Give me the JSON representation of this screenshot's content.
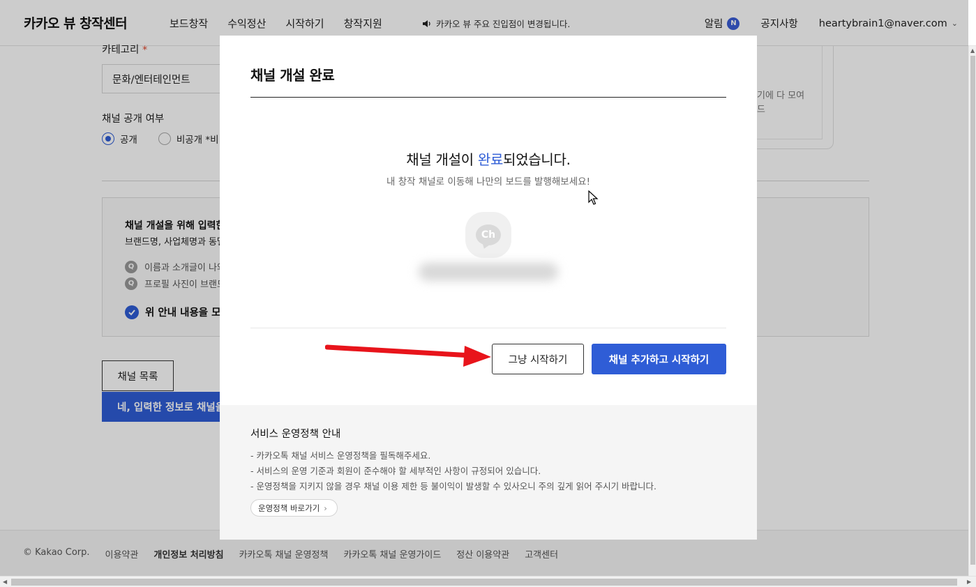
{
  "header": {
    "logo": "카카오 뷰 창작센터",
    "nav": [
      "보드창작",
      "수익정산",
      "시작하기",
      "창작지원"
    ],
    "notice": "카카오 뷰 주요 진입점이 변경됩니다.",
    "alarm_label": "알림",
    "alarm_badge": "N",
    "notice_link": "공지사항",
    "user_email": "heartybrain1@naver.com"
  },
  "form": {
    "category_label": "카테고리",
    "category_required": "*",
    "category_value": "문화/엔터테인먼트",
    "visibility_label": "채널 공개 여부",
    "visibility_options": [
      "공개",
      "비공개 *비"
    ],
    "selected_option": "공개",
    "info_title": "채널 개설을 위해 입력한",
    "info_sub": "브랜드명, 사업체명과 동떨",
    "faq": [
      "이름과 소개글이 나와",
      "프로필 사진이 브랜드"
    ],
    "faq_icon_label": "Q",
    "agree_label": "위 안내 내용을 모두",
    "channel_list_button": "채널 목록",
    "confirm_button": "네, 입력한 정보로 채널을",
    "side_card_text": "기에 다 모여\n드"
  },
  "modal": {
    "title": "채널 개설 완료",
    "done_prefix": "채널 개설이 ",
    "done_highlight": "완료",
    "done_suffix": "되었습니다.",
    "done_sub": "내 창작 채널로 이동해 나만의 보드를 발행해보세요!",
    "avatar_label": "Ch",
    "just_start_button": "그냥 시작하기",
    "add_and_start_button": "채널 추가하고 시작하기",
    "policy_title": "서비스 운영정책 안내",
    "policy_lines": [
      "- 카카오톡 채널 서비스 운영정책을 필독해주세요.",
      "- 서비스의 운영 기준과 회원이 준수해야 할 세부적인 사항이 규정되어 있습니다.",
      "- 운영정책을 지키지 않을 경우 채널 이용 제한 등 불이익이 발생할 수 있사오니 주의 깊게 읽어 주시기 바랍니다."
    ],
    "policy_button": "운영정책 바로가기"
  },
  "footer": {
    "copyright": "© Kakao Corp.",
    "links": [
      "이용약관",
      "개인정보 처리방침",
      "카카오톡 채널 운영정책",
      "카카오톡 채널 운영가이드",
      "정산 이용약관",
      "고객센터"
    ]
  },
  "colors": {
    "accent": "#2f5dd6",
    "annotation_arrow": "#e8141b",
    "required": "#e0452b"
  }
}
